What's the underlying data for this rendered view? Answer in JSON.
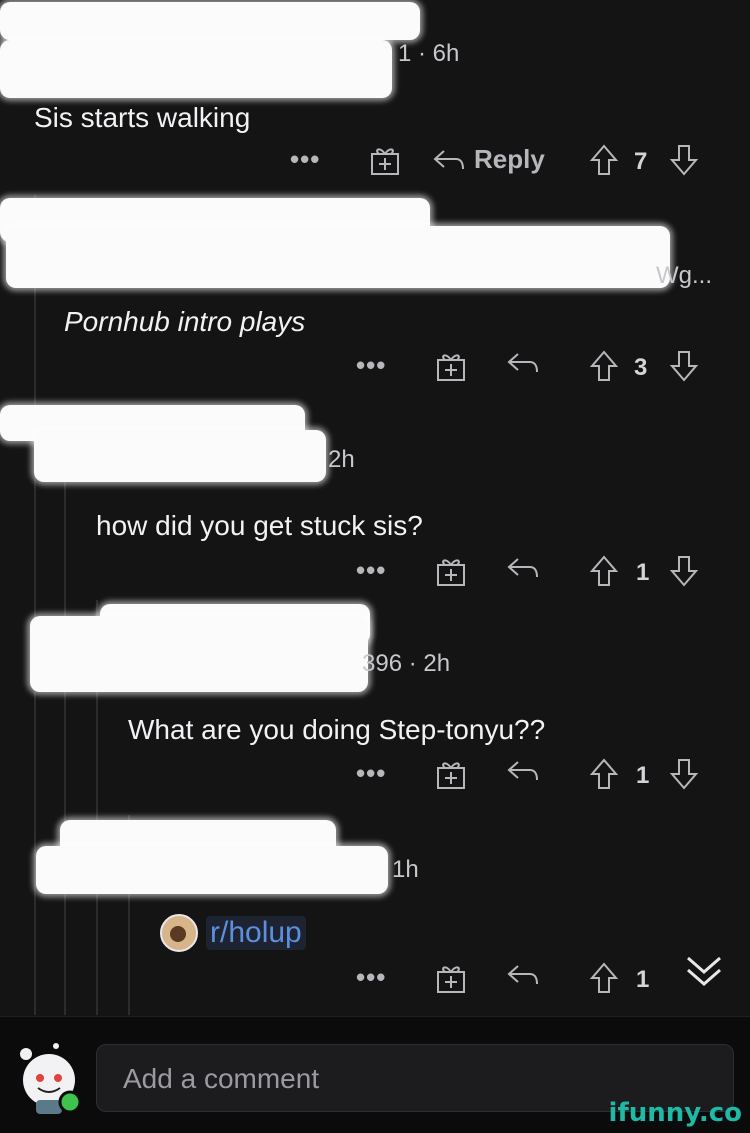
{
  "comments": [
    {
      "time_fragment": "1 · 6h",
      "text": "Sis starts walking",
      "reply_label": "Reply",
      "votes": "7"
    },
    {
      "time_fragment": "Wg...",
      "text": "Pornhub intro plays",
      "reply_label": "",
      "votes": "3"
    },
    {
      "time_fragment": "2h",
      "text": "how did you get stuck sis?",
      "reply_label": "",
      "votes": "1"
    },
    {
      "time_fragment": "396 · 2h",
      "text": "What are you doing Step-tonyu??",
      "reply_label": "",
      "votes": "1"
    },
    {
      "time_fragment": "1h",
      "text": "",
      "link_label": "r/holup",
      "reply_label": "",
      "votes": "1"
    }
  ],
  "actions": {
    "more": "•••"
  },
  "bottom": {
    "placeholder": "Add a comment"
  },
  "watermark": "ifunny.co",
  "icons": {
    "more": "more-dots-icon",
    "award": "gift-icon",
    "reply": "reply-arrow-icon",
    "upvote": "upvote-arrow-icon",
    "downvote": "downvote-arrow-icon"
  },
  "colors": {
    "background": "#141415",
    "link": "#5d8fe0",
    "watermark": "#1fb9a5",
    "online": "#3ec44e"
  }
}
